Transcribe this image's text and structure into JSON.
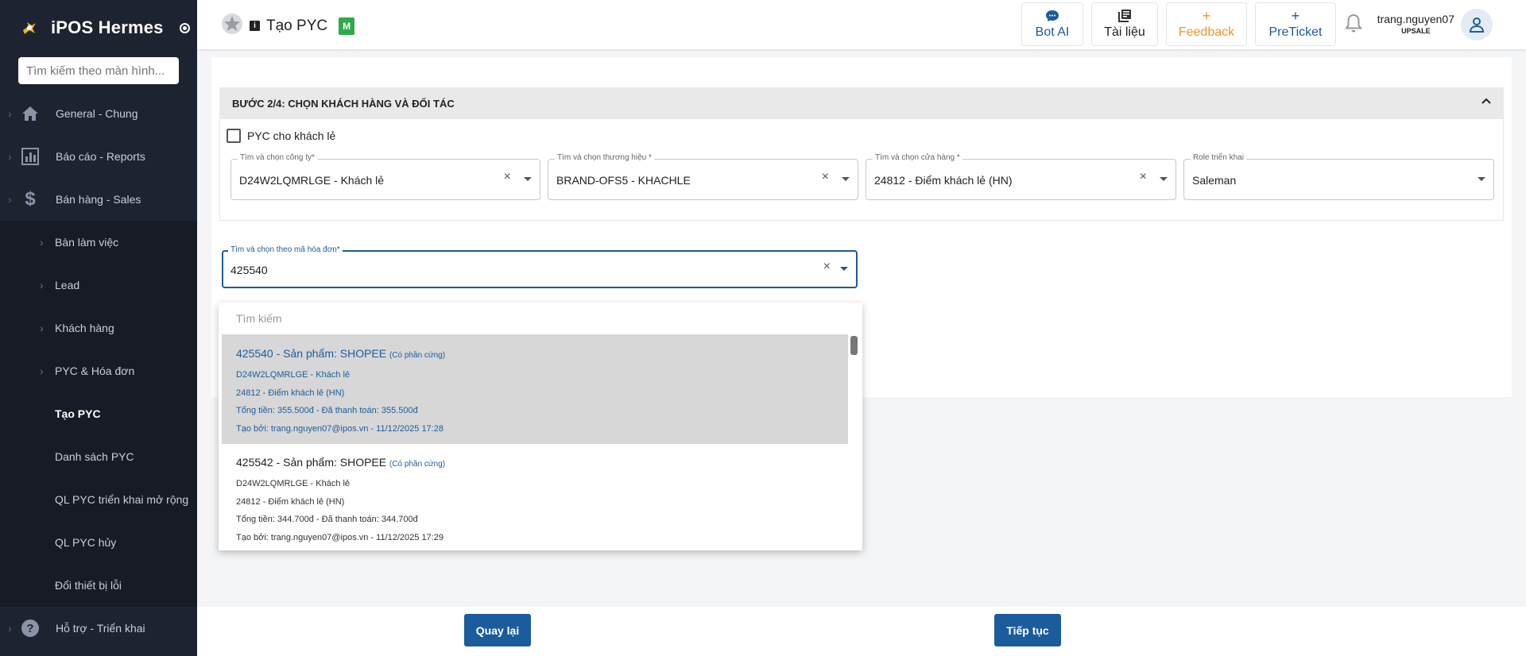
{
  "sidebar": {
    "brand": "iPOS Hermes",
    "search_placeholder": "Tìm kiếm theo màn hình...",
    "items": [
      {
        "label": "General - Chung"
      },
      {
        "label": "Báo cáo - Reports"
      },
      {
        "label": "Bán hàng - Sales"
      }
    ],
    "sales_sub": [
      {
        "label": "Bàn làm việc"
      },
      {
        "label": "Lead"
      },
      {
        "label": "Khách hàng"
      },
      {
        "label": "PYC & Hóa đơn"
      },
      {
        "label": "Tạo PYC"
      },
      {
        "label": "Danh sách PYC"
      },
      {
        "label": "QL PYC triển khai mở rộng"
      },
      {
        "label": "QL PYC hủy"
      },
      {
        "label": "Đổi thiết bị lỗi"
      }
    ],
    "support": {
      "label": "Hỗ trợ - Triển khai"
    }
  },
  "header": {
    "title": "Tạo PYC",
    "badge": "M",
    "buttons": {
      "bot_ai": "Bot AI",
      "docs": "Tài liệu",
      "feedback": "Feedback",
      "preticket": "PreTicket"
    },
    "user": {
      "name": "trang.nguyen07",
      "role": "UPSALE"
    }
  },
  "step": {
    "title": "BƯỚC 2/4: CHỌN KHÁCH HÀNG VÀ ĐỐI TÁC",
    "walkin_label": "PYC cho khách lẻ",
    "fields": {
      "company": {
        "label": "Tìm và chọn công ty*",
        "value": "D24W2LQMRLGE - Khách lẻ"
      },
      "brand": {
        "label": "Tìm và chọn thương hiệu *",
        "value": "BRAND-OFS5 - KHACHLE"
      },
      "store": {
        "label": "Tìm và chọn cửa hàng *",
        "value": "24812 - Điểm khách lẻ (HN)"
      },
      "role": {
        "label": "Role triển khai",
        "value": "Saleman"
      }
    },
    "invoice": {
      "label": "Tìm và chọn theo mã hóa đơn*",
      "value": "425540"
    }
  },
  "dropdown": {
    "search_placeholder": "Tìm kiếm",
    "options": [
      {
        "title": "425540 - Sản phẩm: SHOPEE",
        "tag": "(Có phần cứng)",
        "company": "D24W2LQMRLGE - Khách lẻ",
        "store": "24812 - Điểm khách lẻ (HN)",
        "amount": "Tổng tiền: 355.500đ - Đã thanh toán: 355.500đ",
        "created": "Tạo bởi: trang.nguyen07@ipos.vn - 11/12/2025 17:28"
      },
      {
        "title": "425542 - Sản phẩm: SHOPEE",
        "tag": "(Có phần cứng)",
        "company": "D24W2LQMRLGE - Khách lẻ",
        "store": "24812 - Điểm khách lẻ (HN)",
        "amount": "Tổng tiền: 344.700đ - Đã thanh toán: 344.700đ",
        "created": "Tạo bởi: trang.nguyen07@ipos.vn - 11/12/2025 17:29"
      }
    ]
  },
  "footer": {
    "back": "Quay lại",
    "next": "Tiếp tục"
  },
  "colors": {
    "sidebar_bg": "#1d2330",
    "primary": "#1b5c9c",
    "feedback": "#f0932b",
    "badge_green": "#2daa4b"
  }
}
